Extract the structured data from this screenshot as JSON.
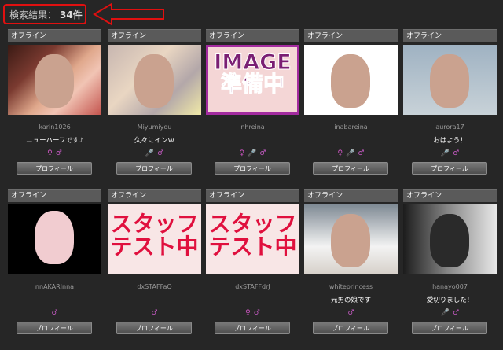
{
  "result": {
    "label": "検索結果：",
    "count": "34件"
  },
  "colors": {
    "accent": "#e01010",
    "card_header": "#5a5a5a"
  },
  "cards": [
    {
      "status": "オフライン",
      "name": "karin1026",
      "comment": "ニューハーフです♪",
      "icons": [
        "♀",
        "♂"
      ],
      "button": "プロフィール"
    },
    {
      "status": "オフライン",
      "name": "Miyumiyou",
      "comment": "久々にインｗ",
      "icons": [
        "🎤",
        "♂"
      ],
      "button": "プロフィール"
    },
    {
      "status": "オフライン",
      "name": "nhreina",
      "comment": "",
      "icons": [
        "♀",
        "🎤",
        "♂"
      ],
      "button": "プロフィール",
      "placeholder": [
        "IMAGE",
        "準備中"
      ]
    },
    {
      "status": "オフライン",
      "name": "inabareina",
      "comment": "",
      "icons": [
        "♀",
        "🎤",
        "♂"
      ],
      "button": "プロフィール"
    },
    {
      "status": "オフライン",
      "name": "aurora17",
      "comment": "おはよう！",
      "icons": [
        "🎤",
        "♂"
      ],
      "button": "プロフィール"
    },
    {
      "status": "オフライン",
      "name": "nnAKARInna",
      "comment": "",
      "icons": [
        "♂"
      ],
      "button": "プロフィール"
    },
    {
      "status": "オフライン",
      "name": "dxSTAFFaQ",
      "comment": "",
      "icons": [
        "♂"
      ],
      "button": "プロフィール",
      "placeholder": [
        "スタッフ",
        "テスト中"
      ]
    },
    {
      "status": "オフライン",
      "name": "dxSTAFFdrJ",
      "comment": "",
      "icons": [
        "♀",
        "♂"
      ],
      "button": "プロフィール",
      "placeholder": [
        "スタッフ",
        "テスト中"
      ]
    },
    {
      "status": "オフライン",
      "name": "whiteprincess",
      "comment": "元男の娘です",
      "icons": [
        "♂"
      ],
      "button": "プロフィール"
    },
    {
      "status": "オフライン",
      "name": "hanayo007",
      "comment": "愛切りました！",
      "icons": [
        "🎤",
        "♂"
      ],
      "button": "プロフィール"
    }
  ]
}
